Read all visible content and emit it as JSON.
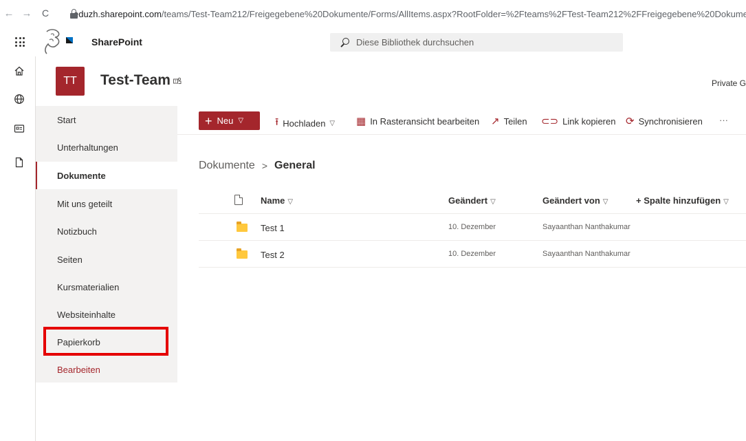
{
  "browser": {
    "back": "←",
    "forward": "→",
    "reload": "C",
    "url_host": "eduzh.sharepoint.com",
    "url_path": "/teams/Test-Team212/Freigegebene%20Dokumente/Forms/AllItems.aspx?RootFolder=%2Fteams%2FTest-Team212%2FFreigegebene%20Dokumer"
  },
  "suitebar": {
    "brand": "SharePoint",
    "search_placeholder": "Diese Bibliothek durchsuchen"
  },
  "site": {
    "initials": "TT",
    "title": "Test-Team",
    "privacy": "Private G"
  },
  "leftnav": {
    "items": [
      {
        "label": "Start"
      },
      {
        "label": "Unterhaltungen"
      },
      {
        "label": "Dokumente"
      },
      {
        "label": "Mit uns geteilt"
      },
      {
        "label": "Notizbuch"
      },
      {
        "label": "Seiten"
      },
      {
        "label": "Kursmaterialien"
      },
      {
        "label": "Websiteinhalte"
      },
      {
        "label": "Papierkorb"
      }
    ],
    "edit_label": "Bearbeiten"
  },
  "commandbar": {
    "new_label": "Neu",
    "upload_label": "Hochladen",
    "grid_label": "In Rasteransicht bearbeiten",
    "share_label": "Teilen",
    "copy_link_label": "Link kopieren",
    "sync_label": "Synchronisieren",
    "more_label": "···"
  },
  "breadcrumb": {
    "parent": "Dokumente",
    "current": "General"
  },
  "list": {
    "columns": {
      "name": "Name",
      "modified": "Geändert",
      "modified_by": "Geändert von",
      "add_column": "+ Spalte hinzufügen"
    },
    "rows": [
      {
        "name": "Test 1",
        "modified": "10. Dezember",
        "modified_by": "Sayaanthan Nanthakumar"
      },
      {
        "name": "Test 2",
        "modified": "10. Dezember",
        "modified_by": "Sayaanthan Nanthakumar"
      }
    ]
  },
  "colors": {
    "accent": "#a4262c",
    "highlight": "#e50000",
    "nav_bg": "#f3f2f1"
  }
}
